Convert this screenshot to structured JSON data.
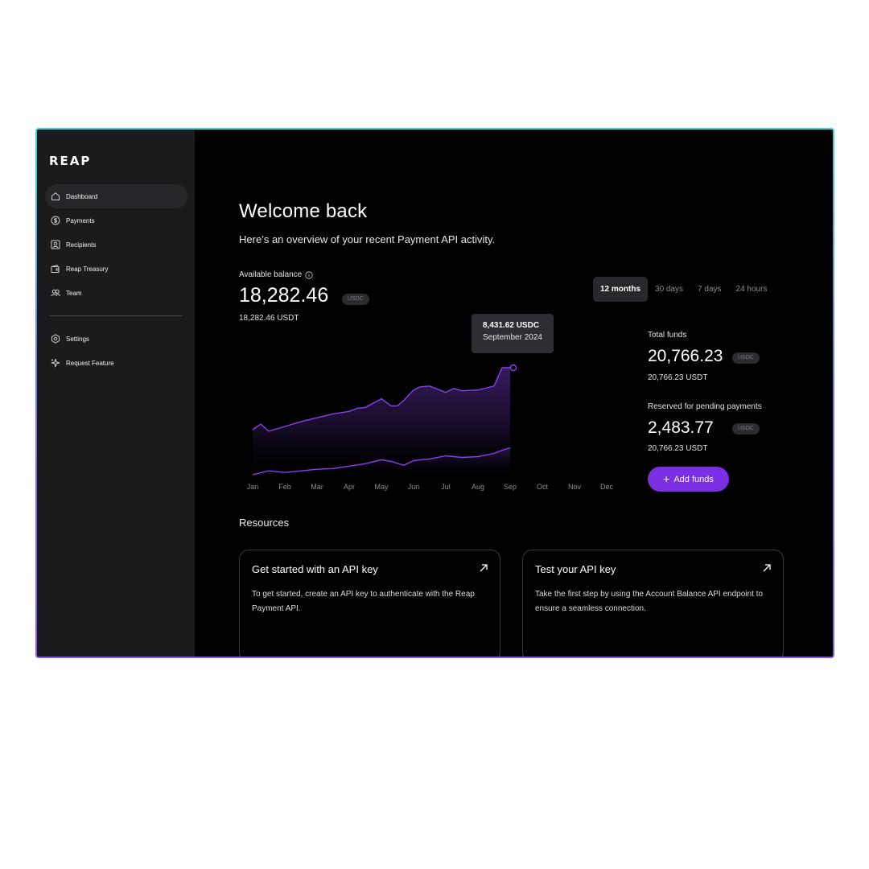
{
  "app": {
    "logo": "REAP"
  },
  "sidebar": {
    "items": [
      {
        "label": "Dashboard",
        "icon": "home-icon",
        "active": true
      },
      {
        "label": "Payments",
        "icon": "dollar-circle-icon"
      },
      {
        "label": "Recipients",
        "icon": "user-card-icon"
      },
      {
        "label": "Reap Treasury",
        "icon": "wallet-icon"
      },
      {
        "label": "Team",
        "icon": "users-icon"
      },
      {
        "label": "Settings",
        "icon": "gear-icon"
      },
      {
        "label": "Request Feature",
        "icon": "sparkle-icon"
      }
    ]
  },
  "header": {
    "title": "Welcome back",
    "subtitle": "Here’s an overview of your recent Payment API activity."
  },
  "balance": {
    "label": "Available balance",
    "value": "18,282.46",
    "currency": "USDC",
    "secondary": "18,282.46 USDT"
  },
  "time_tabs": [
    {
      "label": "12 months",
      "active": true
    },
    {
      "label": "30 days"
    },
    {
      "label": "7 days"
    },
    {
      "label": "24 hours"
    }
  ],
  "tooltip": {
    "value": "8,431.62 USDC",
    "date": "September 2024"
  },
  "summary": {
    "total": {
      "label": "Total funds",
      "value": "20,766.23",
      "currency": "USDC",
      "secondary": "20,766.23 USDT"
    },
    "reserved": {
      "label": "Reserved for pending payments",
      "value": "2,483.77",
      "currency": "USDC",
      "secondary": "20,766.23 USDT"
    }
  },
  "add_funds_label": "Add funds",
  "resources": {
    "title": "Resources",
    "cards": [
      {
        "title": "Get started with an API key",
        "desc": "To get started, create an API key to authenticate with the Reap Payment API."
      },
      {
        "title": "Test your API key",
        "desc": "Take the first step by using the Account Balance API endpoint to ensure a seamless connection."
      }
    ]
  },
  "colors": {
    "accent": "#7b2fe3",
    "line": "#8a3ff0",
    "frame_top": "#3fd3d6",
    "frame_bottom": "#8a5bd6"
  },
  "chart_data": {
    "type": "area",
    "categories": [
      "Jan",
      "Feb",
      "Mar",
      "Apr",
      "May",
      "Jun",
      "Jul",
      "Aug",
      "Sep",
      "Oct",
      "Nov",
      "Dec"
    ],
    "grid": false,
    "series": [
      {
        "x": [
          0,
          0.25,
          0.5,
          0.75,
          1,
          1.5,
          2,
          2.5,
          3,
          3.25,
          3.5,
          4,
          4.3,
          4.5,
          4.7,
          5,
          5.2,
          5.5,
          6,
          6.25,
          6.5,
          7,
          7.5,
          7.75,
          8
        ],
        "values": [
          7650,
          7720,
          7630,
          7660,
          7690,
          7750,
          7800,
          7850,
          7880,
          7920,
          7930,
          8040,
          7950,
          7950,
          8020,
          8150,
          8190,
          8200,
          8120,
          8170,
          8140,
          8150,
          8200,
          8431.62,
          8431.62
        ]
      },
      {
        "x": [
          0,
          0.5,
          1,
          1.5,
          2,
          2.5,
          3,
          3.5,
          4,
          4.3,
          4.7,
          5,
          5.5,
          6,
          6.5,
          7,
          7.5,
          7.75,
          8
        ],
        "values": [
          7080,
          7130,
          7110,
          7130,
          7150,
          7160,
          7190,
          7220,
          7270,
          7250,
          7200,
          7260,
          7280,
          7320,
          7300,
          7310,
          7350,
          7390,
          7420
        ]
      }
    ]
  }
}
